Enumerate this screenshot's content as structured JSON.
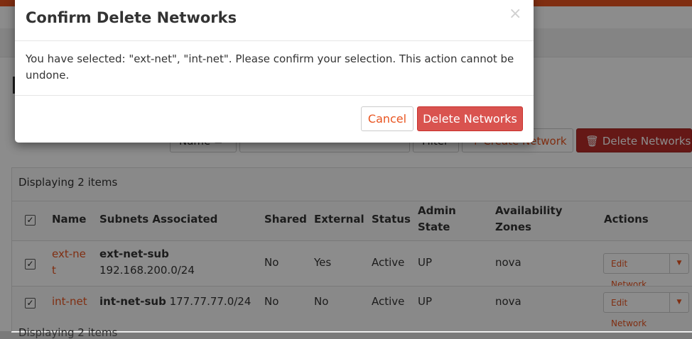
{
  "toolbar": {
    "filter_field_label": "Name =",
    "filter_button": "Filter",
    "create_button": "+ Create Network",
    "delete_button": "Delete Networks"
  },
  "table": {
    "count_top": "Displaying 2 items",
    "count_bottom": "Displaying 2 items",
    "headers": {
      "name": "Name",
      "subnets": "Subnets Associated",
      "shared": "Shared",
      "external": "External",
      "status": "Status",
      "admin_state_1": "Admin",
      "admin_state_2": "State",
      "zones_1": "Availability",
      "zones_2": "Zones",
      "actions": "Actions"
    },
    "rows": [
      {
        "name_1": "ext-ne",
        "name_2": "t",
        "subnet_name": "ext-net-sub",
        "subnet_cidr": "192.168.200.0/24",
        "shared": "No",
        "external": "Yes",
        "status": "Active",
        "admin_state": "UP",
        "zones": "nova",
        "action": "Edit Network"
      },
      {
        "name_1": "int-net",
        "subnet_name": "int-net-sub",
        "subnet_cidr": "177.77.77.0/24",
        "shared": "No",
        "external": "No",
        "status": "Active",
        "admin_state": "UP",
        "zones": "nova",
        "action": "Edit Network"
      }
    ]
  },
  "modal": {
    "title": "Confirm Delete Networks",
    "close": "×",
    "body": "You have selected: \"ext-net\", \"int-net\". Please confirm your selection. This action cannot be undone.",
    "cancel": "Cancel",
    "confirm": "Delete Networks"
  },
  "colors": {
    "accent": "#e95420",
    "danger": "#d9534f",
    "danger_dark": "#b92c28"
  }
}
